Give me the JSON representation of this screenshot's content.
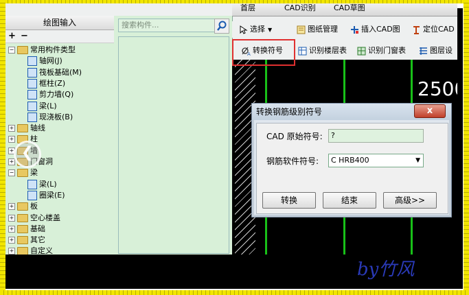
{
  "tree_panel": {
    "title": "绘图输入",
    "tools": [
      "+",
      "−"
    ],
    "rows": [
      {
        "label": "常用构件类型",
        "level": 0,
        "kind": "folder-open"
      },
      {
        "label": "轴网(J)",
        "level": 1,
        "kind": "grid"
      },
      {
        "label": "筏板基础(M)",
        "level": 1,
        "kind": "raft"
      },
      {
        "label": "框柱(Z)",
        "level": 1,
        "kind": "column"
      },
      {
        "label": "剪力墙(Q)",
        "level": 1,
        "kind": "wall"
      },
      {
        "label": "梁(L)",
        "level": 1,
        "kind": "beam"
      },
      {
        "label": "现浇板(B)",
        "level": 1,
        "kind": "slab"
      },
      {
        "label": "轴线",
        "level": 0,
        "kind": "folder"
      },
      {
        "label": "柱",
        "level": 0,
        "kind": "folder"
      },
      {
        "label": "墙",
        "level": 0,
        "kind": "folder"
      },
      {
        "label": "门窗洞",
        "level": 0,
        "kind": "folder"
      },
      {
        "label": "梁",
        "level": 0,
        "kind": "folder-open"
      },
      {
        "label": "梁(L)",
        "level": 1,
        "kind": "beam"
      },
      {
        "label": "圈梁(E)",
        "level": 1,
        "kind": "ring-beam"
      },
      {
        "label": "板",
        "level": 0,
        "kind": "folder"
      },
      {
        "label": "空心楼盖",
        "level": 0,
        "kind": "folder"
      },
      {
        "label": "基础",
        "level": 0,
        "kind": "folder"
      },
      {
        "label": "其它",
        "level": 0,
        "kind": "folder"
      },
      {
        "label": "自定义",
        "level": 0,
        "kind": "folder"
      }
    ]
  },
  "middle_panel": {
    "search_placeholder": "搜索构件..."
  },
  "top_strip": {
    "items": [
      "首层",
      "CAD识别",
      "CAD草图"
    ]
  },
  "toolbar1": {
    "select": "选择",
    "drawing_mgmt": "图纸管理",
    "insert_cad": "插入CAD图",
    "locate_cad": "定位CAD"
  },
  "toolbar2": {
    "convert_symbol": "转换符号",
    "identify_floor_table": "识别楼层表",
    "identify_door_window_table": "识别门窗表",
    "layer_setting": "图层设"
  },
  "canvas": {
    "dimension_text": "2500"
  },
  "dialog": {
    "title": "转换钢筋级别符号",
    "close_label": "x",
    "cad_symbol_label": "CAD 原始符号:",
    "cad_symbol_value": "?",
    "steel_symbol_label": "钢筋软件符号:",
    "steel_symbol_value": "C HRB400",
    "buttons": {
      "convert": "转换",
      "finish": "结束",
      "advanced": "高级>>"
    }
  },
  "watermark": "by竹风",
  "colors": {
    "panel_green": "#d8f0d8",
    "highlight_red": "#e03030",
    "axis_green": "#18c018",
    "frame_yellow": "#f2e600",
    "watermark_blue": "#2a3ab8"
  }
}
